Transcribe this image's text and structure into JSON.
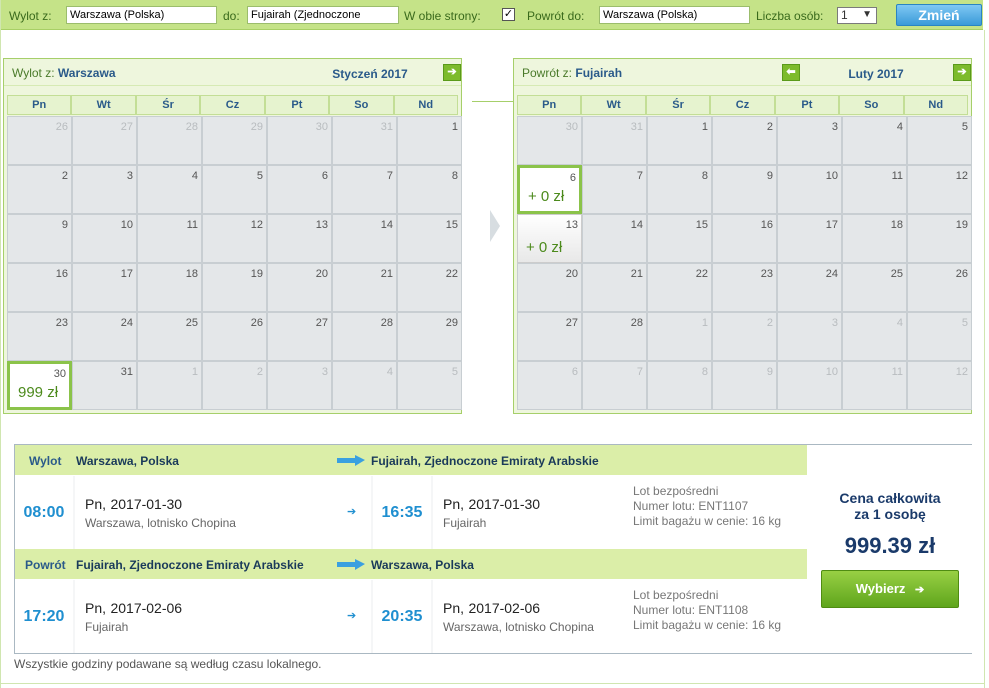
{
  "search": {
    "from_label": "Wylot z:",
    "from_value": "Warszawa (Polska)",
    "to_label": "do:",
    "to_value": "Fujairah (Zjednoczone",
    "round_trip_label": "W obie strony:",
    "round_trip_checked": "✓",
    "return_label": "Powrót do:",
    "return_value": "Warszawa (Polska)",
    "persons_label": "Liczba osób:",
    "persons_value": "1",
    "change_button": "Zmień"
  },
  "outbound_calendar": {
    "title_prefix": "Wylot z:",
    "title_city": "Warszawa",
    "month": "Styczeń 2017",
    "weekdays": [
      "Pn",
      "Wt",
      "Śr",
      "Cz",
      "Pt",
      "So",
      "Nd"
    ],
    "days": [
      {
        "n": "26",
        "o": true
      },
      {
        "n": "27",
        "o": true
      },
      {
        "n": "28",
        "o": true
      },
      {
        "n": "29",
        "o": true
      },
      {
        "n": "30",
        "o": true
      },
      {
        "n": "31",
        "o": true
      },
      {
        "n": "1"
      },
      {
        "n": "2"
      },
      {
        "n": "3"
      },
      {
        "n": "4"
      },
      {
        "n": "5"
      },
      {
        "n": "6"
      },
      {
        "n": "7"
      },
      {
        "n": "8"
      },
      {
        "n": "9"
      },
      {
        "n": "10"
      },
      {
        "n": "11"
      },
      {
        "n": "12"
      },
      {
        "n": "13"
      },
      {
        "n": "14"
      },
      {
        "n": "15"
      },
      {
        "n": "16"
      },
      {
        "n": "17"
      },
      {
        "n": "18"
      },
      {
        "n": "19"
      },
      {
        "n": "20"
      },
      {
        "n": "21"
      },
      {
        "n": "22"
      },
      {
        "n": "23"
      },
      {
        "n": "24"
      },
      {
        "n": "25"
      },
      {
        "n": "26"
      },
      {
        "n": "27"
      },
      {
        "n": "28"
      },
      {
        "n": "29"
      },
      {
        "n": "30",
        "price": "999 zł",
        "sel": true
      },
      {
        "n": "31"
      },
      {
        "n": "1",
        "o": true
      },
      {
        "n": "2",
        "o": true
      },
      {
        "n": "3",
        "o": true
      },
      {
        "n": "4",
        "o": true
      },
      {
        "n": "5",
        "o": true
      }
    ]
  },
  "return_calendar": {
    "title_prefix": "Powrót z:",
    "title_city": "Fujairah",
    "month": "Luty 2017",
    "weekdays": [
      "Pn",
      "Wt",
      "Śr",
      "Cz",
      "Pt",
      "So",
      "Nd"
    ],
    "days": [
      {
        "n": "30",
        "o": true
      },
      {
        "n": "31",
        "o": true
      },
      {
        "n": "1"
      },
      {
        "n": "2"
      },
      {
        "n": "3"
      },
      {
        "n": "4"
      },
      {
        "n": "5"
      },
      {
        "n": "6",
        "price": "+ 0 zł",
        "sel": true
      },
      {
        "n": "7"
      },
      {
        "n": "8"
      },
      {
        "n": "9"
      },
      {
        "n": "10"
      },
      {
        "n": "11"
      },
      {
        "n": "12"
      },
      {
        "n": "13",
        "price": "+ 0 zł"
      },
      {
        "n": "14"
      },
      {
        "n": "15"
      },
      {
        "n": "16"
      },
      {
        "n": "17"
      },
      {
        "n": "18"
      },
      {
        "n": "19"
      },
      {
        "n": "20"
      },
      {
        "n": "21"
      },
      {
        "n": "22"
      },
      {
        "n": "23"
      },
      {
        "n": "24"
      },
      {
        "n": "25"
      },
      {
        "n": "26"
      },
      {
        "n": "27"
      },
      {
        "n": "28"
      },
      {
        "n": "1",
        "o": true
      },
      {
        "n": "2",
        "o": true
      },
      {
        "n": "3",
        "o": true
      },
      {
        "n": "4",
        "o": true
      },
      {
        "n": "5",
        "o": true
      },
      {
        "n": "6",
        "o": true
      },
      {
        "n": "7",
        "o": true
      },
      {
        "n": "8",
        "o": true
      },
      {
        "n": "9",
        "o": true
      },
      {
        "n": "10",
        "o": true
      },
      {
        "n": "11",
        "o": true
      },
      {
        "n": "12",
        "o": true
      }
    ]
  },
  "outbound": {
    "kind": "Wylot",
    "from": "Warszawa, Polska",
    "to": "Fujairah, Zjednoczone Emiraty Arabskie",
    "dep_time": "08:00",
    "dep_day": "Pn,",
    "dep_date": "2017-01-30",
    "dep_place": "Warszawa, lotnisko Chopina",
    "arr_time": "16:35",
    "arr_day": "Pn,",
    "arr_date": "2017-01-30",
    "arr_place": "Fujairah",
    "info1": "Lot bezpośredni",
    "info2": "Numer lotu: ENT1107",
    "info3": "Limit bagażu w cenie: 16 kg"
  },
  "inbound": {
    "kind": "Powrót",
    "from": "Fujairah, Zjednoczone Emiraty Arabskie",
    "to": "Warszawa, Polska",
    "dep_time": "17:20",
    "dep_day": "Pn,",
    "dep_date": "2017-02-06",
    "dep_place": "Fujairah",
    "arr_time": "20:35",
    "arr_day": "Pn,",
    "arr_date": "2017-02-06",
    "arr_place": "Warszawa, lotnisko Chopina",
    "info1": "Lot bezpośredni",
    "info2": "Numer lotu: ENT1108",
    "info3": "Limit bagażu w cenie: 16 kg"
  },
  "price": {
    "label_line1": "Cena całkowita",
    "label_line2": "za 1 osobę",
    "value": "999.39 zł",
    "button": "Wybierz",
    "button_arrow": "➔"
  },
  "footnote": "Wszystkie godziny podawane są według czasu lokalnego.",
  "colors": {
    "accent_green": "#8bc34a",
    "accent_blue": "#1f8fd0",
    "header_green": "#c5e388"
  }
}
